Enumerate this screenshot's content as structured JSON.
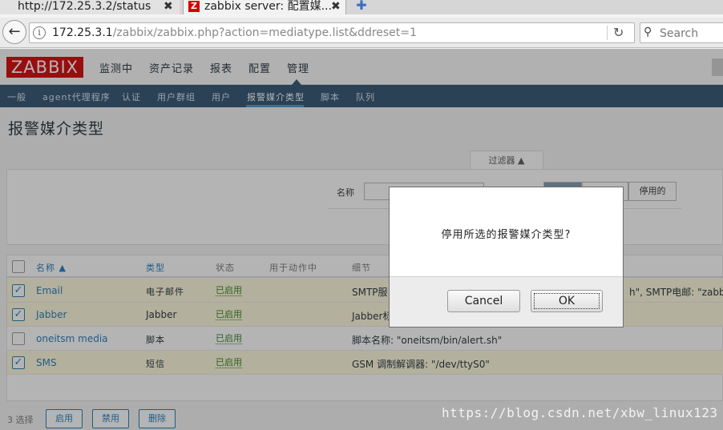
{
  "browser": {
    "tabs": [
      {
        "title": "http://172.25.3.2/status",
        "close": "✖"
      },
      {
        "title": "zabbix server: 配置媒...",
        "close": "✖"
      }
    ],
    "new_tab": "✚",
    "back": "←",
    "url_host": "172.25.3.1",
    "url_path": "/zabbix/zabbix.php?action=mediatype.list&ddreset=1",
    "reload": "↻",
    "search_placeholder": "Search"
  },
  "zabbix": {
    "logo": "ZABBIX",
    "menu": [
      "监测中",
      "资产记录",
      "报表",
      "配置",
      "管理"
    ],
    "submenu": [
      "一般",
      "agent代理程序",
      "认证",
      "用户群组",
      "用户",
      "报警媒介类型",
      "脚本",
      "队列"
    ],
    "page_title": "报警媒介类型"
  },
  "filter": {
    "tab_label": "过滤器 ▲",
    "name_label": "名称",
    "status_options": [
      "",
      "",
      "停用的"
    ]
  },
  "table": {
    "headers": {
      "name": "名称 ▲",
      "type": "类型",
      "status": "状态",
      "used": "用于动作中",
      "details": "细节"
    },
    "rows": [
      {
        "checked": true,
        "name": "Email",
        "type": "电子邮件",
        "status": "已启用",
        "details": "SMTP服",
        "details_tail": "h\", SMTP电邮: \"zabbix@"
      },
      {
        "checked": true,
        "name": "Jabber",
        "type": "Jabber",
        "status": "已启用",
        "details": "Jabber标",
        "details_tail": ""
      },
      {
        "checked": false,
        "name": "oneitsm media",
        "type": "脚本",
        "status": "已启用",
        "details": "脚本名称: \"oneitsm/bin/alert.sh\"",
        "details_tail": ""
      },
      {
        "checked": true,
        "name": "SMS",
        "type": "短信",
        "status": "已启用",
        "details": "GSM 调制解调器: \"/dev/ttyS0\"",
        "details_tail": ""
      }
    ],
    "check_mark": "✓"
  },
  "footer": {
    "selected_count": "3 选择",
    "enable": "启用",
    "disable": "禁用",
    "delete": "删除"
  },
  "watermark": "https://blog.csdn.net/xbw_linux123",
  "dialog": {
    "message": "停用所选的报警媒介类型?",
    "cancel": "Cancel",
    "ok": "OK"
  }
}
